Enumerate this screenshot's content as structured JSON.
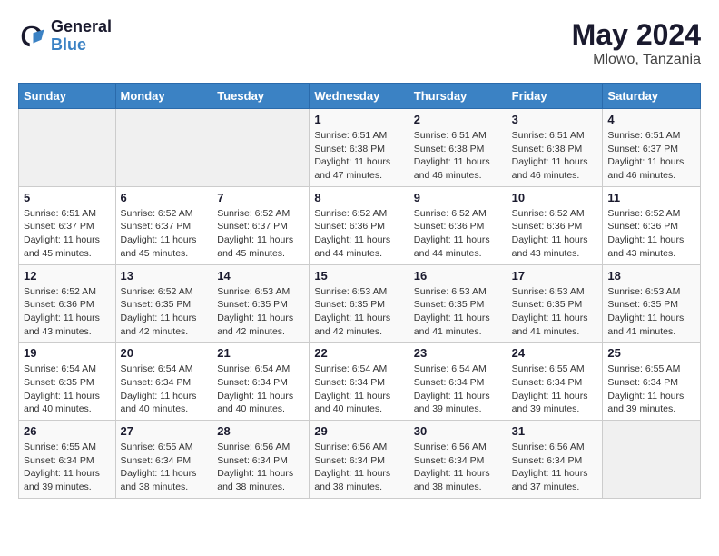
{
  "logo": {
    "text_general": "General",
    "text_blue": "Blue"
  },
  "title": {
    "month_year": "May 2024",
    "location": "Mlowo, Tanzania"
  },
  "days_header": [
    "Sunday",
    "Monday",
    "Tuesday",
    "Wednesday",
    "Thursday",
    "Friday",
    "Saturday"
  ],
  "weeks": [
    [
      {
        "day": "",
        "info": ""
      },
      {
        "day": "",
        "info": ""
      },
      {
        "day": "",
        "info": ""
      },
      {
        "day": "1",
        "info": "Sunrise: 6:51 AM\nSunset: 6:38 PM\nDaylight: 11 hours and 47 minutes."
      },
      {
        "day": "2",
        "info": "Sunrise: 6:51 AM\nSunset: 6:38 PM\nDaylight: 11 hours and 46 minutes."
      },
      {
        "day": "3",
        "info": "Sunrise: 6:51 AM\nSunset: 6:38 PM\nDaylight: 11 hours and 46 minutes."
      },
      {
        "day": "4",
        "info": "Sunrise: 6:51 AM\nSunset: 6:37 PM\nDaylight: 11 hours and 46 minutes."
      }
    ],
    [
      {
        "day": "5",
        "info": "Sunrise: 6:51 AM\nSunset: 6:37 PM\nDaylight: 11 hours and 45 minutes."
      },
      {
        "day": "6",
        "info": "Sunrise: 6:52 AM\nSunset: 6:37 PM\nDaylight: 11 hours and 45 minutes."
      },
      {
        "day": "7",
        "info": "Sunrise: 6:52 AM\nSunset: 6:37 PM\nDaylight: 11 hours and 45 minutes."
      },
      {
        "day": "8",
        "info": "Sunrise: 6:52 AM\nSunset: 6:36 PM\nDaylight: 11 hours and 44 minutes."
      },
      {
        "day": "9",
        "info": "Sunrise: 6:52 AM\nSunset: 6:36 PM\nDaylight: 11 hours and 44 minutes."
      },
      {
        "day": "10",
        "info": "Sunrise: 6:52 AM\nSunset: 6:36 PM\nDaylight: 11 hours and 43 minutes."
      },
      {
        "day": "11",
        "info": "Sunrise: 6:52 AM\nSunset: 6:36 PM\nDaylight: 11 hours and 43 minutes."
      }
    ],
    [
      {
        "day": "12",
        "info": "Sunrise: 6:52 AM\nSunset: 6:36 PM\nDaylight: 11 hours and 43 minutes."
      },
      {
        "day": "13",
        "info": "Sunrise: 6:52 AM\nSunset: 6:35 PM\nDaylight: 11 hours and 42 minutes."
      },
      {
        "day": "14",
        "info": "Sunrise: 6:53 AM\nSunset: 6:35 PM\nDaylight: 11 hours and 42 minutes."
      },
      {
        "day": "15",
        "info": "Sunrise: 6:53 AM\nSunset: 6:35 PM\nDaylight: 11 hours and 42 minutes."
      },
      {
        "day": "16",
        "info": "Sunrise: 6:53 AM\nSunset: 6:35 PM\nDaylight: 11 hours and 41 minutes."
      },
      {
        "day": "17",
        "info": "Sunrise: 6:53 AM\nSunset: 6:35 PM\nDaylight: 11 hours and 41 minutes."
      },
      {
        "day": "18",
        "info": "Sunrise: 6:53 AM\nSunset: 6:35 PM\nDaylight: 11 hours and 41 minutes."
      }
    ],
    [
      {
        "day": "19",
        "info": "Sunrise: 6:54 AM\nSunset: 6:35 PM\nDaylight: 11 hours and 40 minutes."
      },
      {
        "day": "20",
        "info": "Sunrise: 6:54 AM\nSunset: 6:34 PM\nDaylight: 11 hours and 40 minutes."
      },
      {
        "day": "21",
        "info": "Sunrise: 6:54 AM\nSunset: 6:34 PM\nDaylight: 11 hours and 40 minutes."
      },
      {
        "day": "22",
        "info": "Sunrise: 6:54 AM\nSunset: 6:34 PM\nDaylight: 11 hours and 40 minutes."
      },
      {
        "day": "23",
        "info": "Sunrise: 6:54 AM\nSunset: 6:34 PM\nDaylight: 11 hours and 39 minutes."
      },
      {
        "day": "24",
        "info": "Sunrise: 6:55 AM\nSunset: 6:34 PM\nDaylight: 11 hours and 39 minutes."
      },
      {
        "day": "25",
        "info": "Sunrise: 6:55 AM\nSunset: 6:34 PM\nDaylight: 11 hours and 39 minutes."
      }
    ],
    [
      {
        "day": "26",
        "info": "Sunrise: 6:55 AM\nSunset: 6:34 PM\nDaylight: 11 hours and 39 minutes."
      },
      {
        "day": "27",
        "info": "Sunrise: 6:55 AM\nSunset: 6:34 PM\nDaylight: 11 hours and 38 minutes."
      },
      {
        "day": "28",
        "info": "Sunrise: 6:56 AM\nSunset: 6:34 PM\nDaylight: 11 hours and 38 minutes."
      },
      {
        "day": "29",
        "info": "Sunrise: 6:56 AM\nSunset: 6:34 PM\nDaylight: 11 hours and 38 minutes."
      },
      {
        "day": "30",
        "info": "Sunrise: 6:56 AM\nSunset: 6:34 PM\nDaylight: 11 hours and 38 minutes."
      },
      {
        "day": "31",
        "info": "Sunrise: 6:56 AM\nSunset: 6:34 PM\nDaylight: 11 hours and 37 minutes."
      },
      {
        "day": "",
        "info": ""
      }
    ]
  ]
}
